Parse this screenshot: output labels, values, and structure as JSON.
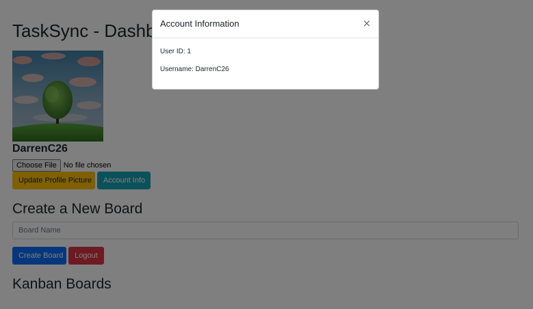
{
  "page": {
    "title": "TaskSync - Dashboard",
    "username": "DarrenC26"
  },
  "profile": {
    "choose_file_label": "Choose File",
    "file_status": "No file chosen",
    "update_picture_label": "Update Profile Picture",
    "account_info_label": "Account Info"
  },
  "create_board": {
    "heading": "Create a New Board",
    "input_placeholder": "Board Name",
    "create_label": "Create Board",
    "logout_label": "Logout"
  },
  "kanban": {
    "heading": "Kanban Boards"
  },
  "modal": {
    "title": "Account Information",
    "close_glyph": "×",
    "user_id_line": "User ID: 1",
    "username_line": "Username: DarrenC26"
  },
  "colors": {
    "update_button": "#ffc107",
    "account_info_button": "#17a2b8",
    "create_button": "#0d6efd",
    "logout_button": "#dc3545"
  },
  "icons": {
    "close": "close-icon"
  }
}
